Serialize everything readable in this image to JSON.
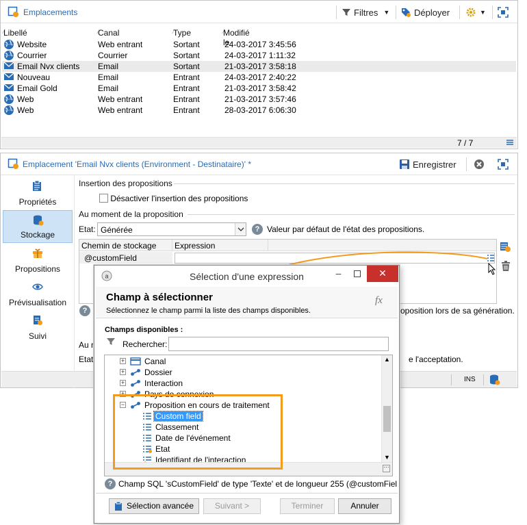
{
  "top_panel": {
    "title": "Emplacements",
    "filters_label": "Filtres",
    "deploy_label": "Déployer",
    "columns": [
      "Libellé",
      "Canal",
      "Type",
      "Modifié le"
    ],
    "rows": [
      {
        "label": "Website",
        "channel": "Web entrant",
        "type": "Sortant",
        "modified": "24-03-2017 3:45:56",
        "icon": "web-globe-icon"
      },
      {
        "label": "Courrier",
        "channel": "Courrier",
        "type": "Sortant",
        "modified": "24-03-2017 1:11:32",
        "icon": "web-globe-icon"
      },
      {
        "label": "Email Nvx clients",
        "channel": "Email",
        "type": "Sortant",
        "modified": "21-03-2017 3:58:18",
        "icon": "email-envelope-icon"
      },
      {
        "label": "Nouveau",
        "channel": "Email",
        "type": "Entrant",
        "modified": "24-03-2017 2:40:22",
        "icon": "email-envelope-icon"
      },
      {
        "label": "Email Gold",
        "channel": "Email",
        "type": "Entrant",
        "modified": "21-03-2017 3:58:42",
        "icon": "email-envelope-icon"
      },
      {
        "label": "Web",
        "channel": "Web entrant",
        "type": "Entrant",
        "modified": "21-03-2017 3:57:46",
        "icon": "web-globe-icon"
      },
      {
        "label": "Web",
        "channel": "Web entrant",
        "type": "Entrant",
        "modified": "28-03-2017 6:06:30",
        "icon": "web-globe-icon"
      }
    ],
    "count": "7 / 7"
  },
  "bottom_panel": {
    "title": "Emplacement 'Email Nvx clients (Environment - Destinataire)' *",
    "save_label": "Enregistrer",
    "nav": [
      {
        "label": "Propriétés",
        "icon": "properties-icon"
      },
      {
        "label": "Stockage",
        "icon": "storage-icon"
      },
      {
        "label": "Propositions",
        "icon": "gift-icon"
      },
      {
        "label": "Prévisualisation",
        "icon": "eye-icon"
      },
      {
        "label": "Suivi",
        "icon": "tracking-icon"
      }
    ],
    "insertion_title": "Insertion des propositions",
    "disable_insertion_label": "Désactiver l'insertion des propositions",
    "moment_title": "Au moment de la proposition",
    "state_label": "Etat:",
    "state_value": "Générée",
    "state_help": "Valeur par défaut de l'état des propositions.",
    "table_col1": "Chemin de stockage",
    "table_col2": "Expression",
    "table_row1": "@customField",
    "help_after": "oposition lors de sa génération.",
    "au_label": "Au n",
    "etat_label2": "Etat",
    "acceptance_text": "e l'acceptation.",
    "ins_label": "INS"
  },
  "dialog": {
    "title": "Sélection d'une expression",
    "heading": "Champ à sélectionner",
    "subheading": "Sélectionnez le champ parmi la liste des champs disponibles.",
    "fx_label": "fx",
    "available_label": "Champs disponibles :",
    "search_label": "Rechercher:",
    "search_value": "",
    "tree": [
      {
        "label": "Canal",
        "level": 0,
        "expander": "+",
        "icon": "table-icon"
      },
      {
        "label": "Dossier",
        "level": 0,
        "expander": "+",
        "icon": "link-icon"
      },
      {
        "label": "Interaction",
        "level": 0,
        "expander": "+",
        "icon": "link-icon"
      },
      {
        "label": "Pays de connexion",
        "level": 0,
        "expander": "+",
        "icon": "link-icon"
      },
      {
        "label": "Proposition en cours de traitement",
        "level": 0,
        "expander": "−",
        "icon": "link-icon"
      },
      {
        "label": "Custom field",
        "level": 1,
        "expander": "",
        "icon": "field-icon",
        "selected": true
      },
      {
        "label": "Classement",
        "level": 1,
        "expander": "",
        "icon": "field-icon"
      },
      {
        "label": "Date de l'événement",
        "level": 1,
        "expander": "",
        "icon": "field-icon"
      },
      {
        "label": "Etat",
        "level": 1,
        "expander": "",
        "icon": "enum-field-icon"
      },
      {
        "label": "Identifiant de l'interaction",
        "level": 1,
        "expander": "",
        "icon": "key-field-icon"
      }
    ],
    "status_text": "Champ SQL 'sCustomField' de type 'Texte' et de longueur 255 (@customFiel",
    "btn_advanced": "Sélection avancée",
    "btn_next": "Suivant >",
    "btn_finish": "Terminer",
    "btn_cancel": "Annuler"
  },
  "colors": {
    "accent_blue": "#2a6bb5",
    "highlight_orange": "#f29b1d",
    "selection_blue": "#3399ff",
    "close_red": "#c8302c"
  }
}
